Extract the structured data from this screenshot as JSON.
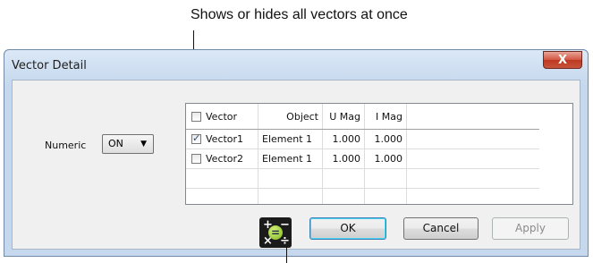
{
  "callout": {
    "text": "Shows or hides all vectors at once"
  },
  "window": {
    "title": "Vector Detail",
    "close_glyph": "X"
  },
  "numeric": {
    "label": "Numeric",
    "value": "ON",
    "arrow": "▼"
  },
  "grid": {
    "headers": [
      "Vector",
      "Object",
      "U Mag",
      "I Mag"
    ],
    "header_checkbox_checked": false,
    "rows": [
      {
        "checked": true,
        "vector": "Vector1",
        "object": "Element 1",
        "u_mag": "1.000",
        "i_mag": "1.000"
      },
      {
        "checked": false,
        "vector": "Vector2",
        "object": "Element 1",
        "u_mag": "1.000",
        "i_mag": "1.000"
      }
    ]
  },
  "calc_icon": {
    "icon": "calculator-icon",
    "plus": "+",
    "minus": "−",
    "times": "×",
    "divide": "÷",
    "equals": "="
  },
  "buttons": {
    "ok": "OK",
    "cancel": "Cancel",
    "apply": "Apply"
  }
}
